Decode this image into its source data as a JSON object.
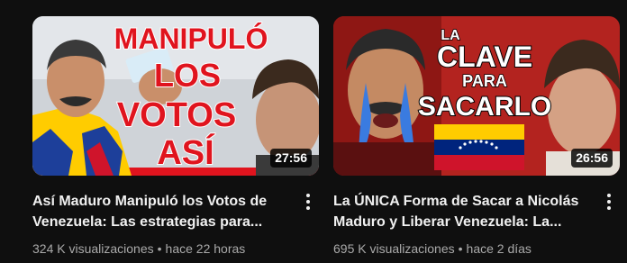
{
  "videos": [
    {
      "thumbnail_text": [
        "MANIPULÓ",
        "LOS",
        "VOTOS",
        "ASÍ"
      ],
      "duration": "27:56",
      "title": "Así Maduro Manipuló los Votos de Venezuela: Las estrategias para...",
      "views": "324 K visualizaciones",
      "separator": "•",
      "age": "hace 22 horas",
      "menu_icon": "more-vert-icon"
    },
    {
      "thumbnail_text": [
        "LA",
        "CLAVE",
        "PARA",
        "SACARLO"
      ],
      "duration": "26:56",
      "title": "La ÚNICA Forma de Sacar a Nicolás Maduro y Liberar Venezuela: La...",
      "views": "695 K visualizaciones",
      "separator": "•",
      "age": "hace 2 días",
      "menu_icon": "more-vert-icon"
    }
  ],
  "colors": {
    "background": "#0f0f0f",
    "title_text": "#f1f1f1",
    "meta_text": "#aaaaaa",
    "thumbnail_red": "#e0141e",
    "venezuela_yellow": "#ffcc00",
    "venezuela_blue": "#00247d",
    "venezuela_red": "#cf142b"
  }
}
